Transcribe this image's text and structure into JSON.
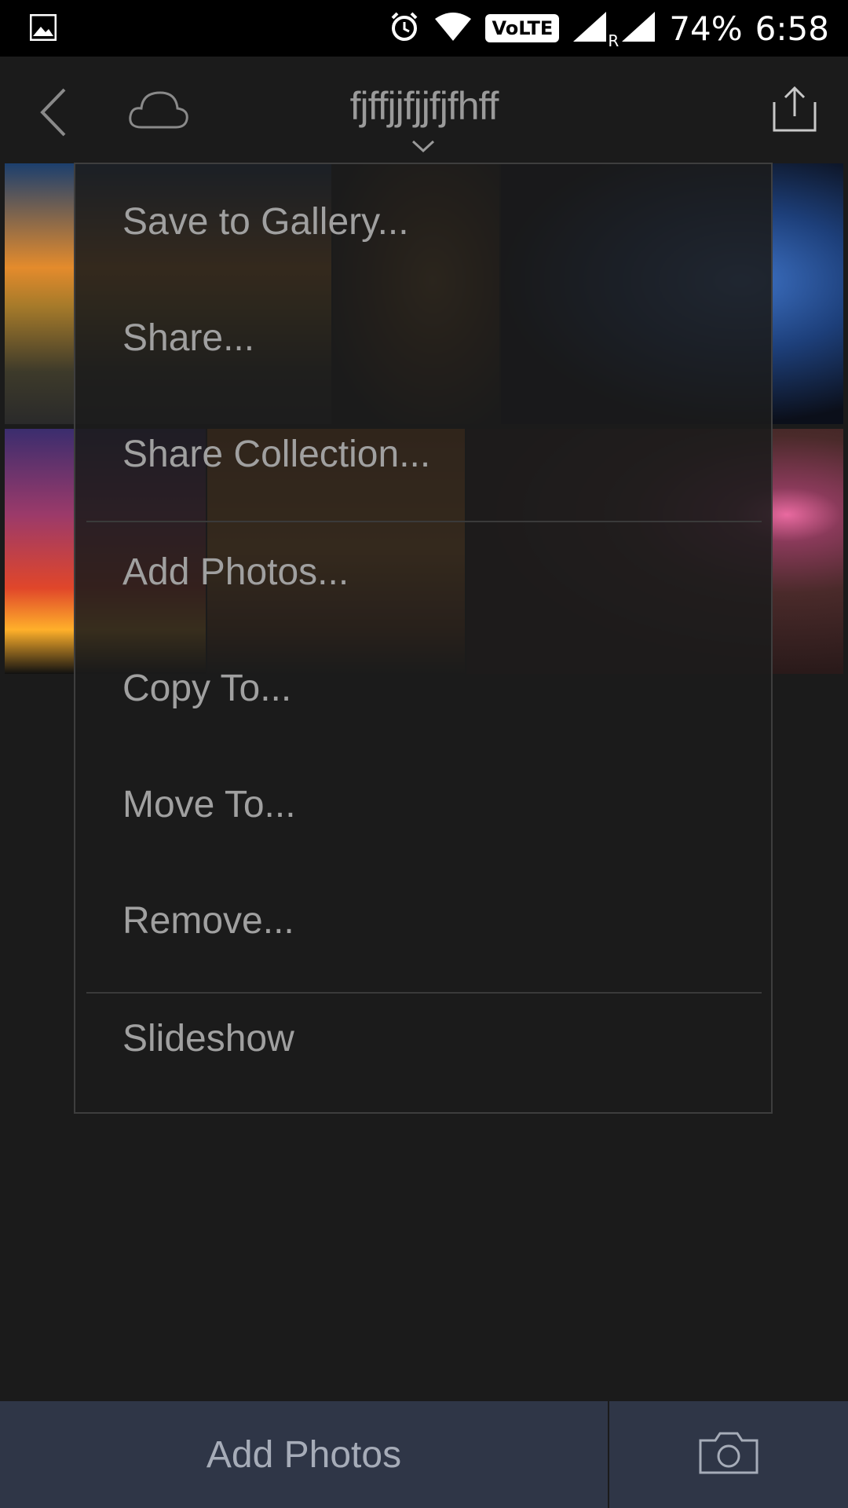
{
  "status_bar": {
    "battery": "74%",
    "time": "6:58",
    "volte": "VoLTE",
    "roaming": "R",
    "icons": [
      "gallery-icon",
      "alarm-icon",
      "wifi-icon",
      "signal-icon",
      "signal-icon"
    ]
  },
  "app_bar": {
    "title": "fjffjjfjjfjfhff",
    "icons": [
      "back-icon",
      "cloud-icon",
      "chevron-down-icon",
      "share-icon"
    ]
  },
  "menu": {
    "items": [
      "Save to Gallery...",
      "Share...",
      "Share Collection...",
      "Add Photos...",
      "Copy To...",
      "Move To...",
      "Remove...",
      "Slideshow"
    ]
  },
  "bottom_bar": {
    "add_photos_label": "Add Photos",
    "camera_icon": "camera-icon"
  },
  "colors": {
    "background": "#1b1b1b",
    "bottom_bar": "#2f3647",
    "menu_text": "#a0a0a0"
  }
}
